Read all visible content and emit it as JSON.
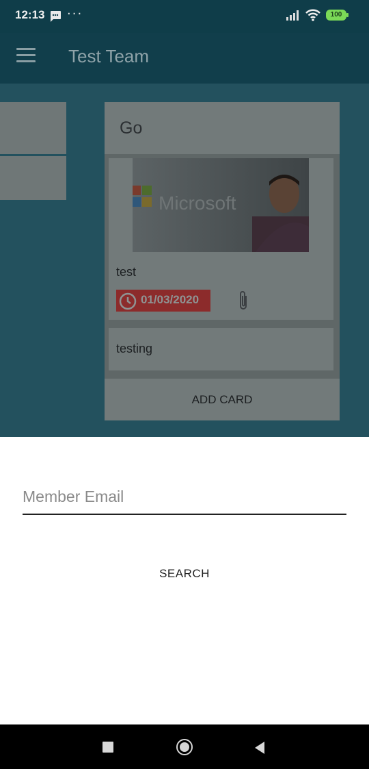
{
  "status_bar": {
    "time": "12:13",
    "dots": "···",
    "battery": "100"
  },
  "app_bar": {
    "title": "Test Team"
  },
  "board": {
    "list": {
      "title": "Go",
      "cards": [
        {
          "title": "test",
          "image_text": "Microsoft",
          "due_date": "01/03/2020"
        },
        {
          "title": "testing"
        }
      ],
      "add_card_label": "ADD CARD"
    }
  },
  "sheet": {
    "email_placeholder": "Member Email",
    "email_value": "",
    "search_label": "SEARCH"
  }
}
